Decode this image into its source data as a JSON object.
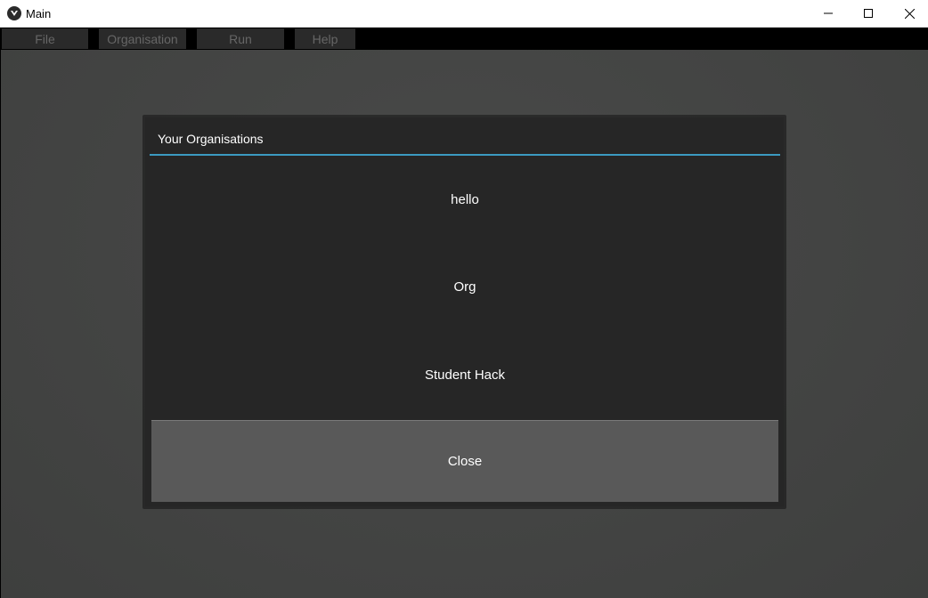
{
  "window": {
    "title": "Main",
    "controls": [
      "minimize-icon",
      "maximize-icon",
      "close-icon"
    ]
  },
  "menubar": {
    "items": [
      {
        "label": "File"
      },
      {
        "label": "Organisation"
      },
      {
        "label": "Run"
      },
      {
        "label": "Help"
      }
    ]
  },
  "dialog": {
    "title": "Your Organisations",
    "accent_color": "#3b9ac1",
    "organisations": [
      {
        "label": "hello"
      },
      {
        "label": "Org"
      },
      {
        "label": "Student Hack"
      }
    ],
    "close_label": "Close"
  }
}
